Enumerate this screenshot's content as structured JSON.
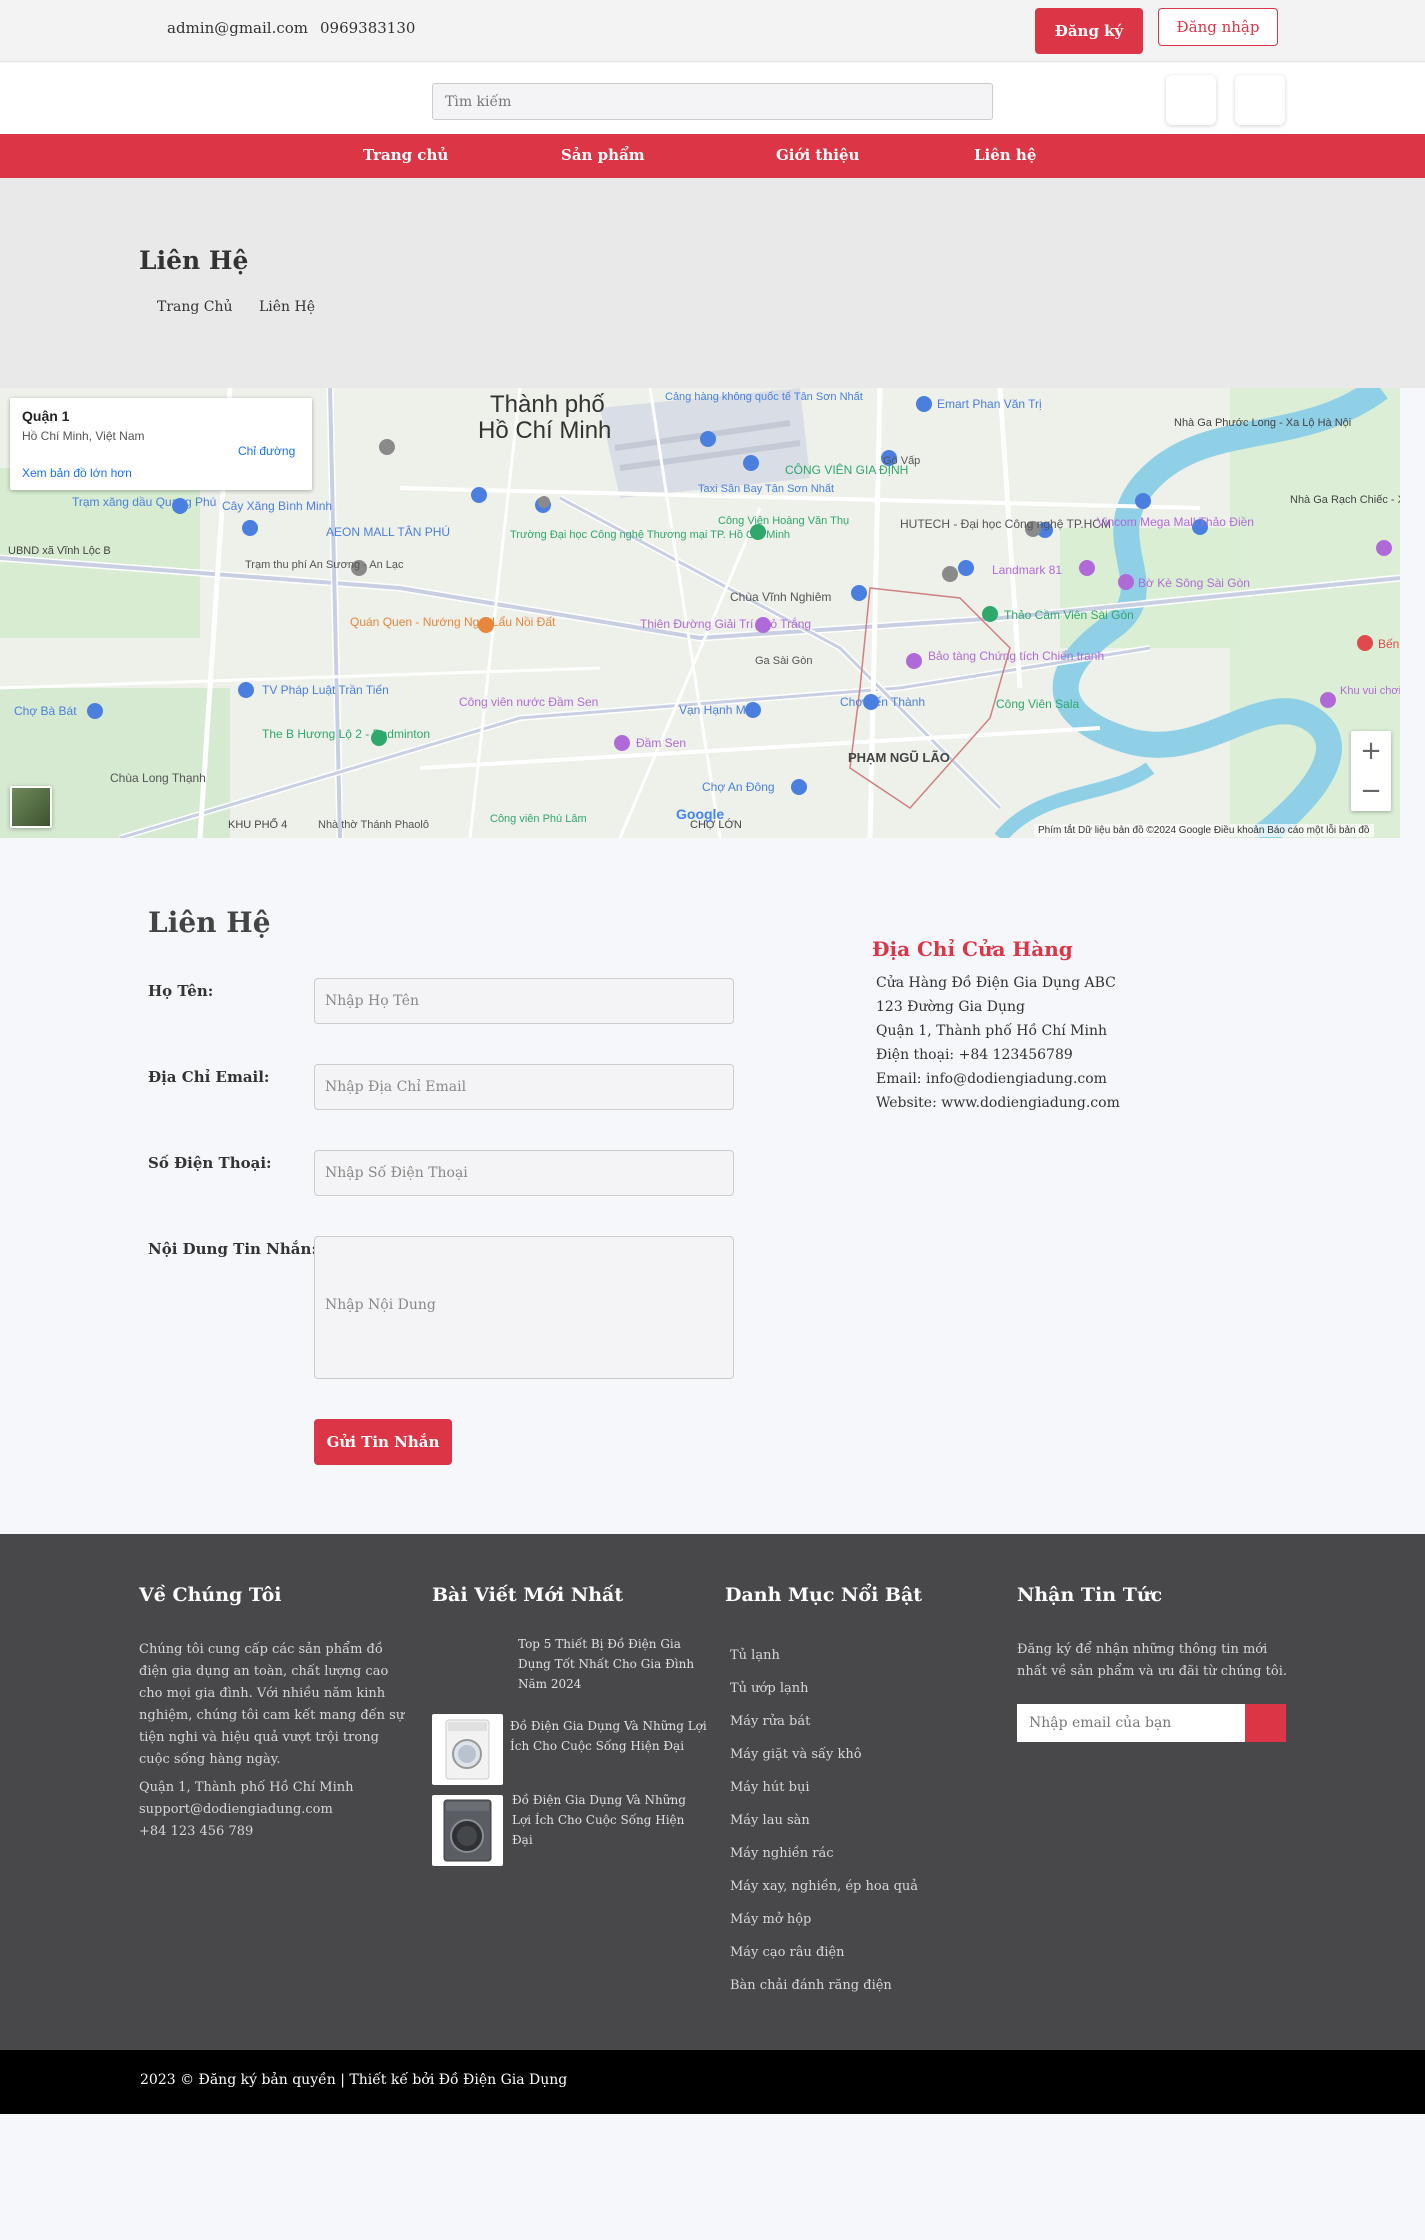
{
  "header": {
    "email": "admin@gmail.com",
    "phone": "0969383130",
    "register_label": "Đăng ký",
    "login_label": "Đăng nhập"
  },
  "search": {
    "placeholder": "Tìm kiếm"
  },
  "nav": {
    "items": [
      "Trang chủ",
      "Sản phẩm",
      "Giới thiệu",
      "Liên hệ"
    ]
  },
  "page": {
    "title": "Liên Hệ",
    "breadcrumb": [
      "Trang Chủ",
      "Liên Hệ"
    ]
  },
  "map": {
    "card_title": "Quận 1",
    "card_subtitle": "Hồ Chí Minh, Việt Nam",
    "directions_label": "Chỉ đường",
    "larger_map_label": "Xem bản đồ lớn hơn",
    "zoom_in": "+",
    "zoom_out": "−",
    "attribution": "Phím tắt    Dữ liệu bản đồ ©2024 Google    Điều khoản    Báo cáo một lỗi bản đồ",
    "logo": "Google",
    "labels": {
      "city": "Thành phố",
      "city2": "Hồ Chí Minh",
      "airport": "Cảng hàng không quốc tế Tân Sơn Nhất",
      "l1": "Emart Phan Văn Trị",
      "l2": "Gò Vấp",
      "l3": "CÔNG VIÊN GIA ĐỊNH",
      "l4": "HUTECH - Đại học Công nghệ TP.HCM",
      "l5": "Vincom Mega Mall Thảo Điền",
      "l6": "AEON MALL TÂN PHÚ",
      "l7": "Cây Xăng Bình Minh",
      "l8": "Trạm xăng dầu Quang Phú",
      "l9": "Chùa Vĩnh Nghiêm",
      "l10": "Landmark 81",
      "l11": "Bờ Kè Sông Sài Gòn",
      "l12": "Thảo Cầm Viên Sài Gòn",
      "l13": "Thiên Đường Giải Trí Thỏ Trắng",
      "l14": "Ga Sài Gòn",
      "l15": "Bảo tàng Chứng tích Chiến tranh",
      "l16": "Quán Quen - Nướng Ngói Lẩu Nồi Đất",
      "l17": "TV Pháp Luật Trần Tiến",
      "l18": "Công viên nước Đầm Sen",
      "l19": "Vạn Hạnh Mall",
      "l20": "Chợ Bến Thành",
      "l21": "Công Viên Sala",
      "l22": "PHẠM NGŨ LÃO",
      "l23": "Đầm Sen",
      "l24": "Chợ An Đông",
      "l25": "The B Hương Lộ 2 - Badminton",
      "l26": "Chùa Long Thạnh",
      "l27": "Chợ Bà Bát",
      "l28": "CHỢ LỚN",
      "l29": "KHU PHỐ 4",
      "l30": "Nhà Ga Phước Long - Xa Lộ Hà Nội",
      "l31": "Nhà Ga Rạch Chiếc - Xa Lộ Hà Nội",
      "l32": "Khu vui chơi Snow Town",
      "l33": "Trường Đại học Công nghệ Thương mại TP. Hồ Chí Minh",
      "l34": "Taxi Sân Bay Tân Sơn Nhất",
      "l35": "Công Viên Hoàng Văn Thụ",
      "l36": "Trạm thu phí An Sương - An Lạc",
      "l37": "UBND xã Vĩnh Lộc B",
      "l38": "Công viên Phú Lâm",
      "l39": "Nhà thờ Thánh Phaolô",
      "l40": "Bến"
    }
  },
  "contact_form": {
    "title": "Liên Hệ",
    "name_label": "Họ Tên:",
    "name_placeholder": "Nhập Họ Tên",
    "email_label": "Địa Chỉ Email:",
    "email_placeholder": "Nhập Địa Chỉ Email",
    "phone_label": "Số Điện Thoại:",
    "phone_placeholder": "Nhập Số Điện Thoại",
    "message_label": "Nội Dung Tin Nhắn:",
    "message_placeholder": "Nhập Nội Dung",
    "submit_label": "Gửi Tin Nhắn"
  },
  "store": {
    "title": "Địa Chỉ Cửa Hàng",
    "lines": [
      "Cửa Hàng Đồ Điện Gia Dụng ABC",
      "123 Đường Gia Dụng",
      "Quận 1, Thành phố Hồ Chí Minh",
      "Điện thoại: +84 123456789",
      "Email: info@dodiengiadung.com",
      "Website: www.dodiengiadung.com"
    ]
  },
  "footer": {
    "about_title": "Về Chúng Tôi",
    "about_text": "Chúng tôi cung cấp các sản phẩm đồ điện gia dụng an toàn, chất lượng cao cho mọi gia đình. Với nhiều năm kinh nghiệm, chúng tôi cam kết mang đến sự tiện nghi và hiệu quả vượt trội trong cuộc sống hàng ngày.",
    "address": "Quận 1, Thành phố Hồ Chí Minh",
    "email": "support@dodiengiadung.com",
    "phone": "+84 123 456 789",
    "posts_title": "Bài Viết Mới Nhất",
    "posts": [
      "Top 5 Thiết Bị Đồ Điện Gia Dụng Tốt Nhất Cho Gia Đình Năm 2024",
      "Đồ Điện Gia Dụng Và Những Lợi Ích Cho Cuộc Sống Hiện Đại",
      "Đồ Điện Gia Dụng Và Những Lợi Ích Cho Cuộc Sống Hiện Đại"
    ],
    "categories_title": "Danh Mục Nổi Bật",
    "categories": [
      "Tủ lạnh",
      "Tủ ướp lạnh",
      "Máy rửa bát",
      "Máy giặt và sấy khô",
      "Máy hút bụi",
      "Máy lau sàn",
      "Máy nghiền rác",
      "Máy xay, nghiền, ép hoa quả",
      "Máy mở hộp",
      "Máy cạo râu điện",
      "Bàn chải đánh răng điện"
    ],
    "newsletter_title": "Nhận Tin Tức",
    "newsletter_text": "Đăng ký để nhận những thông tin mới nhất về sản phẩm và ưu đãi từ chúng tôi.",
    "newsletter_placeholder": "Nhập email của bạn",
    "copyright": "2023 © Đăng ký bản quyền | Thiết kế bởi Đồ Điện Gia Dụng"
  },
  "colors": {
    "accent": "#dc3545",
    "footer_bg": "#48484b",
    "copy_bg": "#000000",
    "page_bg": "#f5f7fb"
  }
}
